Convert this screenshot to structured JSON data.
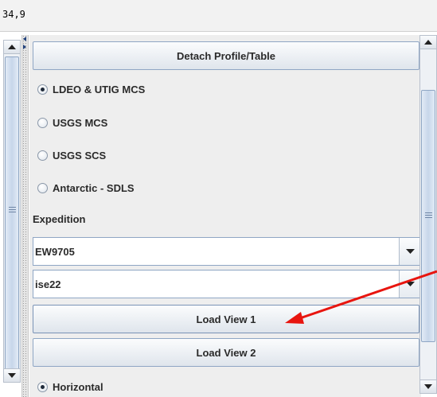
{
  "coordinate_readout": "34,9",
  "panel": {
    "detach_button_label": "Detach Profile/Table",
    "data_sources": [
      {
        "label": "LDEO & UTIG MCS",
        "selected": true
      },
      {
        "label": "USGS MCS",
        "selected": false
      },
      {
        "label": "USGS SCS",
        "selected": false
      },
      {
        "label": "Antarctic - SDLS",
        "selected": false
      }
    ],
    "expedition_label": "Expedition",
    "expedition_value": "EW9705",
    "line_value": "ise22",
    "load_view_1_label": "Load View 1",
    "load_view_2_label": "Load View 2",
    "orientation_option": {
      "label": "Horizontal",
      "selected": true
    }
  },
  "annotation": {
    "arrow_color": "#e8150f"
  },
  "icons": {
    "scroll_up": "triangle-up-icon",
    "scroll_down": "triangle-down-icon",
    "dropdown": "chevron-down-icon",
    "thumb_grip": "grip-lines-icon"
  }
}
